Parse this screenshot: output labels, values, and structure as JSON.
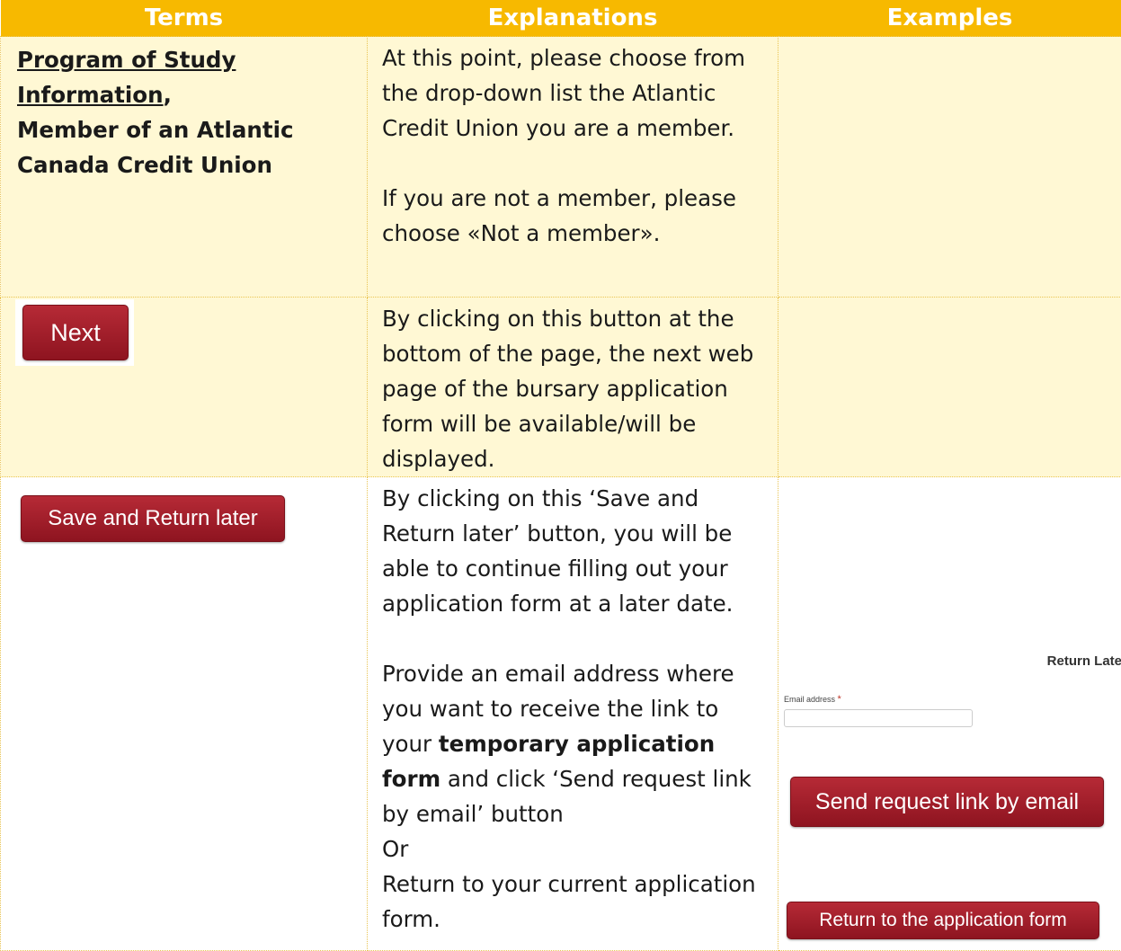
{
  "header": {
    "terms": "Terms",
    "explanations": "Explanations",
    "examples": "Examples"
  },
  "rows": [
    {
      "term_line1": "Program of Study Information",
      "term_comma": ",",
      "term_line2": "Member of an Atlantic Canada Credit Union",
      "explanation_p1": "At this point, please choose from the drop-down list the Atlantic Credit Union you are a member.",
      "explanation_p2": "If you are not a member, please choose «Not a member»."
    },
    {
      "button_label": "Next",
      "explanation": "By clicking on this button at the bottom of the page, the next web page of the bursary application form will be available/will be displayed."
    },
    {
      "button_label": "Save and Return later",
      "explanation_p1": "By clicking on this ‘Save and Return later’ button, you will be able to continue filling out your application form at a later date.",
      "explanation_p2_before": "Provide an email address where you want to receive the link to your ",
      "explanation_p2_bold": "temporary application form",
      "explanation_p2_after": " and click ‘Send request link by email’ button",
      "explanation_or": "Or",
      "explanation_p3": "Return to your current application form.",
      "example": {
        "title": "Return Late",
        "email_label": "Email address",
        "required_mark": "*",
        "email_value": "",
        "send_button": "Send request link by email",
        "return_button": "Return to the application form"
      }
    }
  ],
  "colors": {
    "header_bg": "#f7b900",
    "row_highlight": "#fff8d4",
    "button_red": "#a11d2a"
  }
}
